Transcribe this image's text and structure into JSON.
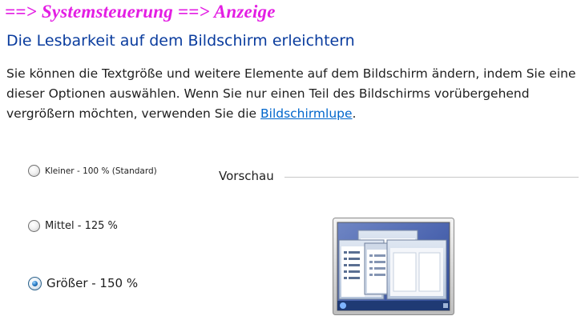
{
  "nav_heading": "==> Systemsteuerung ==> Anzeige",
  "page_title": "Die Lesbarkeit auf dem Bildschirm erleichtern",
  "description": {
    "text_before_link": "Sie können die Textgröße und weitere Elemente auf dem Bildschirm ändern, indem Sie eine dieser Optionen auswählen. Wenn Sie nur einen Teil des Bildschirms vorübergehend vergrößern möchten, verwenden Sie die ",
    "link_text": "Bildschirmlupe",
    "text_after_link": "."
  },
  "options": [
    {
      "label": "Kleiner - 100 % (Standard)",
      "checked": false
    },
    {
      "label": "Mittel - 125 %",
      "checked": false
    },
    {
      "label": "Größer - 150 %",
      "checked": true
    }
  ],
  "preview": {
    "label": "Vorschau",
    "image_icon": "desktop-windows-preview-icon"
  },
  "colors": {
    "nav_heading": "#e31ee3",
    "page_title": "#0a3c9e",
    "link": "#0066cc"
  }
}
